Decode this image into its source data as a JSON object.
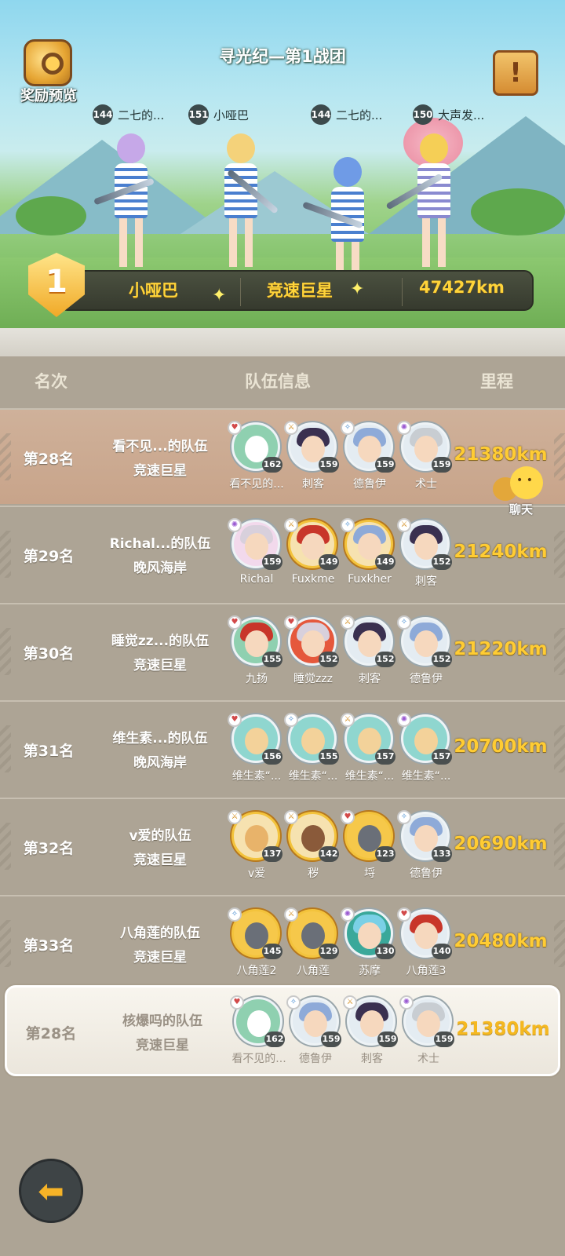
{
  "header": {
    "title": "寻光纪—第1战团",
    "reward_label": "奖励预览"
  },
  "top_team": {
    "members": [
      {
        "level": "144",
        "name": "二七的..."
      },
      {
        "level": "151",
        "name": "小哑巴"
      },
      {
        "level": "144",
        "name": "二七的..."
      },
      {
        "level": "150",
        "name": "大声发..."
      }
    ],
    "rank": "1",
    "leader": "小哑巴",
    "route": "竞速巨星",
    "distance": "47427km"
  },
  "columns": {
    "rank": "名次",
    "team": "队伍信息",
    "distance": "里程"
  },
  "rows": [
    {
      "rank": "第28名",
      "team": "看不见...的队伍",
      "route": "竞速巨星",
      "distance": "21380km",
      "members": [
        {
          "level": "162",
          "name": "看不见的..."
        },
        {
          "level": "159",
          "name": "刺客"
        },
        {
          "level": "159",
          "name": "德鲁伊"
        },
        {
          "level": "159",
          "name": "术士"
        }
      ]
    },
    {
      "rank": "第29名",
      "team": "Richal...的队伍",
      "route": "晚风海岸",
      "distance": "21240km",
      "members": [
        {
          "level": "159",
          "name": "Richal"
        },
        {
          "level": "149",
          "name": "Fuxkme"
        },
        {
          "level": "149",
          "name": "Fuxkher"
        },
        {
          "level": "152",
          "name": "刺客"
        }
      ]
    },
    {
      "rank": "第30名",
      "team": "睡觉zz...的队伍",
      "route": "竞速巨星",
      "distance": "21220km",
      "members": [
        {
          "level": "155",
          "name": "九扬"
        },
        {
          "level": "152",
          "name": "睡觉zzz"
        },
        {
          "level": "152",
          "name": "刺客"
        },
        {
          "level": "152",
          "name": "德鲁伊"
        }
      ]
    },
    {
      "rank": "第31名",
      "team": "维生素...的队伍",
      "route": "晚风海岸",
      "distance": "20700km",
      "members": [
        {
          "level": "156",
          "name": "维生素“..."
        },
        {
          "level": "155",
          "name": "维生素“..."
        },
        {
          "level": "157",
          "name": "维生素“..."
        },
        {
          "level": "157",
          "name": "维生素“..."
        }
      ]
    },
    {
      "rank": "第32名",
      "team": "v爱的队伍",
      "route": "竞速巨星",
      "distance": "20690km",
      "members": [
        {
          "level": "137",
          "name": "v爱"
        },
        {
          "level": "142",
          "name": "秽"
        },
        {
          "level": "123",
          "name": "埒"
        },
        {
          "level": "133",
          "name": "德鲁伊"
        }
      ]
    },
    {
      "rank": "第33名",
      "team": "八角莲的队伍",
      "route": "竞速巨星",
      "distance": "20480km",
      "members": [
        {
          "level": "145",
          "name": "八角莲2"
        },
        {
          "level": "129",
          "name": "八角莲"
        },
        {
          "level": "130",
          "name": "苏摩"
        },
        {
          "level": "140",
          "name": "八角莲3"
        }
      ]
    }
  ],
  "my_row": {
    "rank": "第28名",
    "team": "核爆吗的队伍",
    "route": "竞速巨星",
    "distance": "21380km",
    "members": [
      {
        "level": "162",
        "name": "看不见的..."
      },
      {
        "level": "159",
        "name": "德鲁伊"
      },
      {
        "level": "159",
        "name": "刺客"
      },
      {
        "level": "159",
        "name": "术士"
      }
    ]
  },
  "chat": {
    "label": "聊天"
  },
  "icons": {
    "reward": "trophy-key-icon",
    "notice": "exclamation-icon",
    "back": "back-arrow-icon",
    "chat": "chat-bubble-icon"
  },
  "colors": {
    "distance": "#ffcc33",
    "highlight_row": "#c8a48a",
    "background": "#ada495"
  }
}
